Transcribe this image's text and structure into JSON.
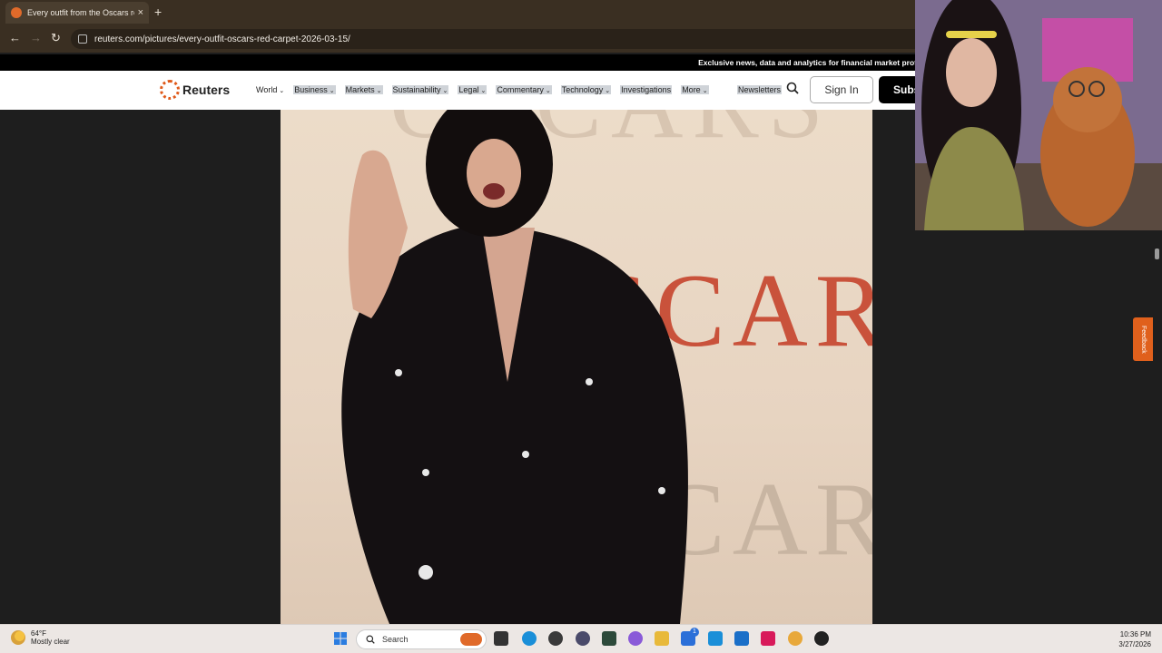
{
  "browser": {
    "tab_title": "Every outfit from the Oscars re",
    "tab_close": "×",
    "new_tab": "+",
    "url": "reuters.com/pictures/every-outfit-oscars-red-carpet-2026-03-15/",
    "back": "←",
    "forward": "→",
    "reload": "↻"
  },
  "site": {
    "promo": "Exclusive news, data and analytics for financial market prof",
    "logo_text": "Reuters",
    "nav": [
      {
        "label": "World",
        "caret": "⌄"
      },
      {
        "label": "Business",
        "caret": "⌄"
      },
      {
        "label": "Markets",
        "caret": "⌄"
      },
      {
        "label": "Sustainability",
        "caret": "⌄"
      },
      {
        "label": "Legal",
        "caret": "⌄"
      },
      {
        "label": "Commentary",
        "caret": "⌄"
      },
      {
        "label": "Technology",
        "caret": "⌄"
      },
      {
        "label": "Investigations",
        "caret": ""
      },
      {
        "label": "More",
        "caret": "⌄"
      }
    ],
    "newsletters": "Newsletters",
    "signin": "Sign In",
    "subscribe": "Subs",
    "feedback": "Feedback"
  },
  "photo": {
    "backdrop_text_1": "OSCARS",
    "backdrop_text_2": "OSCARS",
    "backdrop_text_3": "OSCARS"
  },
  "taskbar": {
    "temp": "64°F",
    "weather": "Mostly clear",
    "search": "Search",
    "time": "10:36 PM",
    "date": "3/27/2026",
    "badge": "1"
  },
  "colors": {
    "accent": "#e05a1a",
    "chrome": "#3a2f22"
  }
}
